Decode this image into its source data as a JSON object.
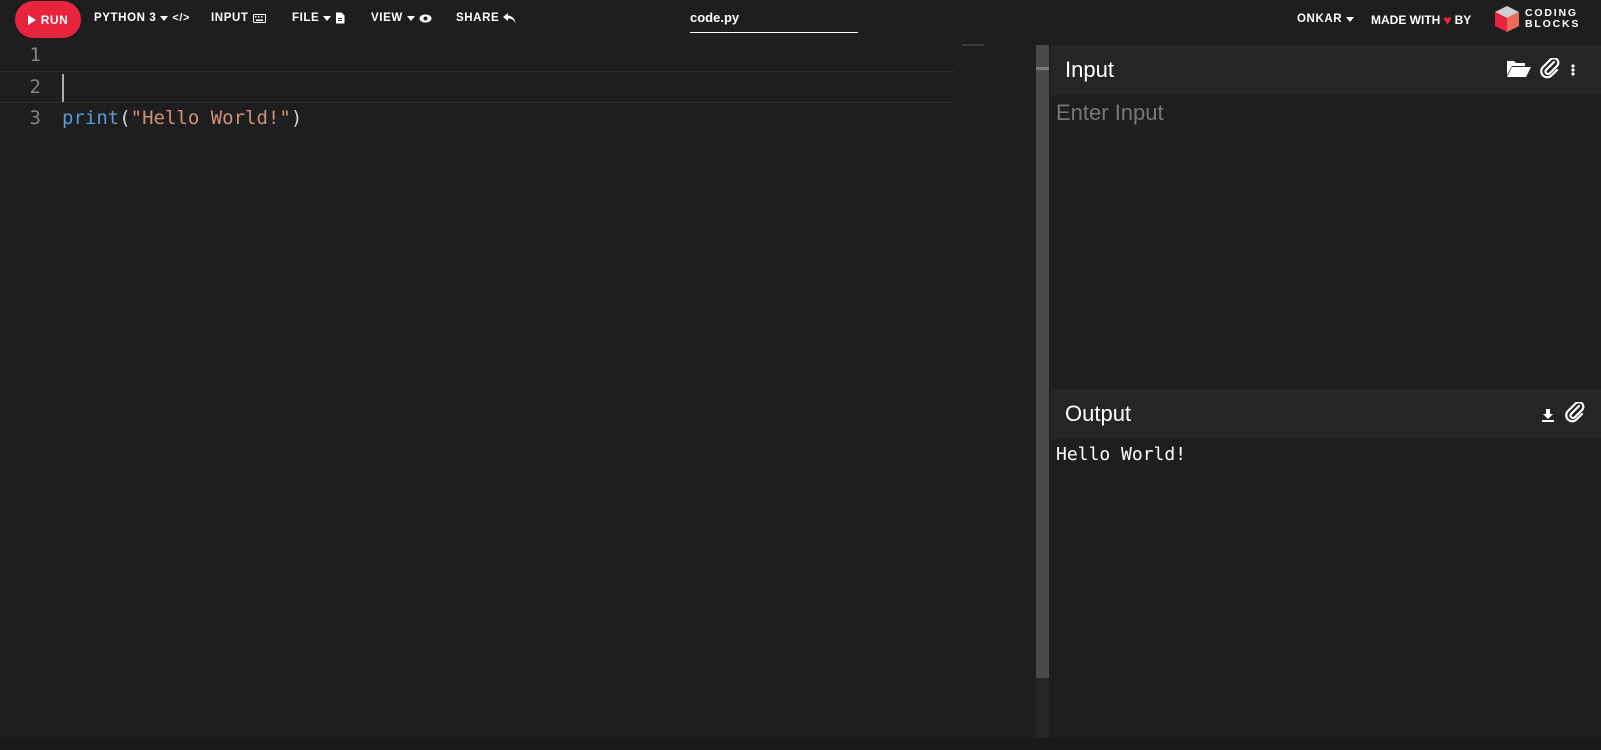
{
  "toolbar": {
    "run_label": "RUN",
    "language_label": "PYTHON 3",
    "input_label": "INPUT",
    "file_label": "FILE",
    "view_label": "VIEW",
    "share_label": "SHARE",
    "filename": "code.py",
    "user_label": "ONKAR",
    "made_with_label": "MADE WITH",
    "by_label": "BY",
    "logo_line1": "CODING",
    "logo_line2": "BLOCKS"
  },
  "editor": {
    "lines": [
      {
        "num": "1",
        "text": ""
      },
      {
        "num": "2",
        "text": ""
      },
      {
        "num": "3",
        "tokens": {
          "fn": "print",
          "open": "(",
          "str": "\"Hello World!\"",
          "close": ")"
        }
      }
    ]
  },
  "input_panel": {
    "title": "Input",
    "placeholder": "Enter Input",
    "icons": [
      "folder-open-icon",
      "paperclip-icon",
      "more-vertical-icon"
    ]
  },
  "output_panel": {
    "title": "Output",
    "text": "Hello World!",
    "icons": [
      "download-icon",
      "paperclip-icon"
    ]
  },
  "colors": {
    "accent": "#e8233c",
    "background": "#1e1e1e",
    "panel_header": "#252526",
    "keyword": "#569cd6",
    "string": "#ce9178"
  }
}
